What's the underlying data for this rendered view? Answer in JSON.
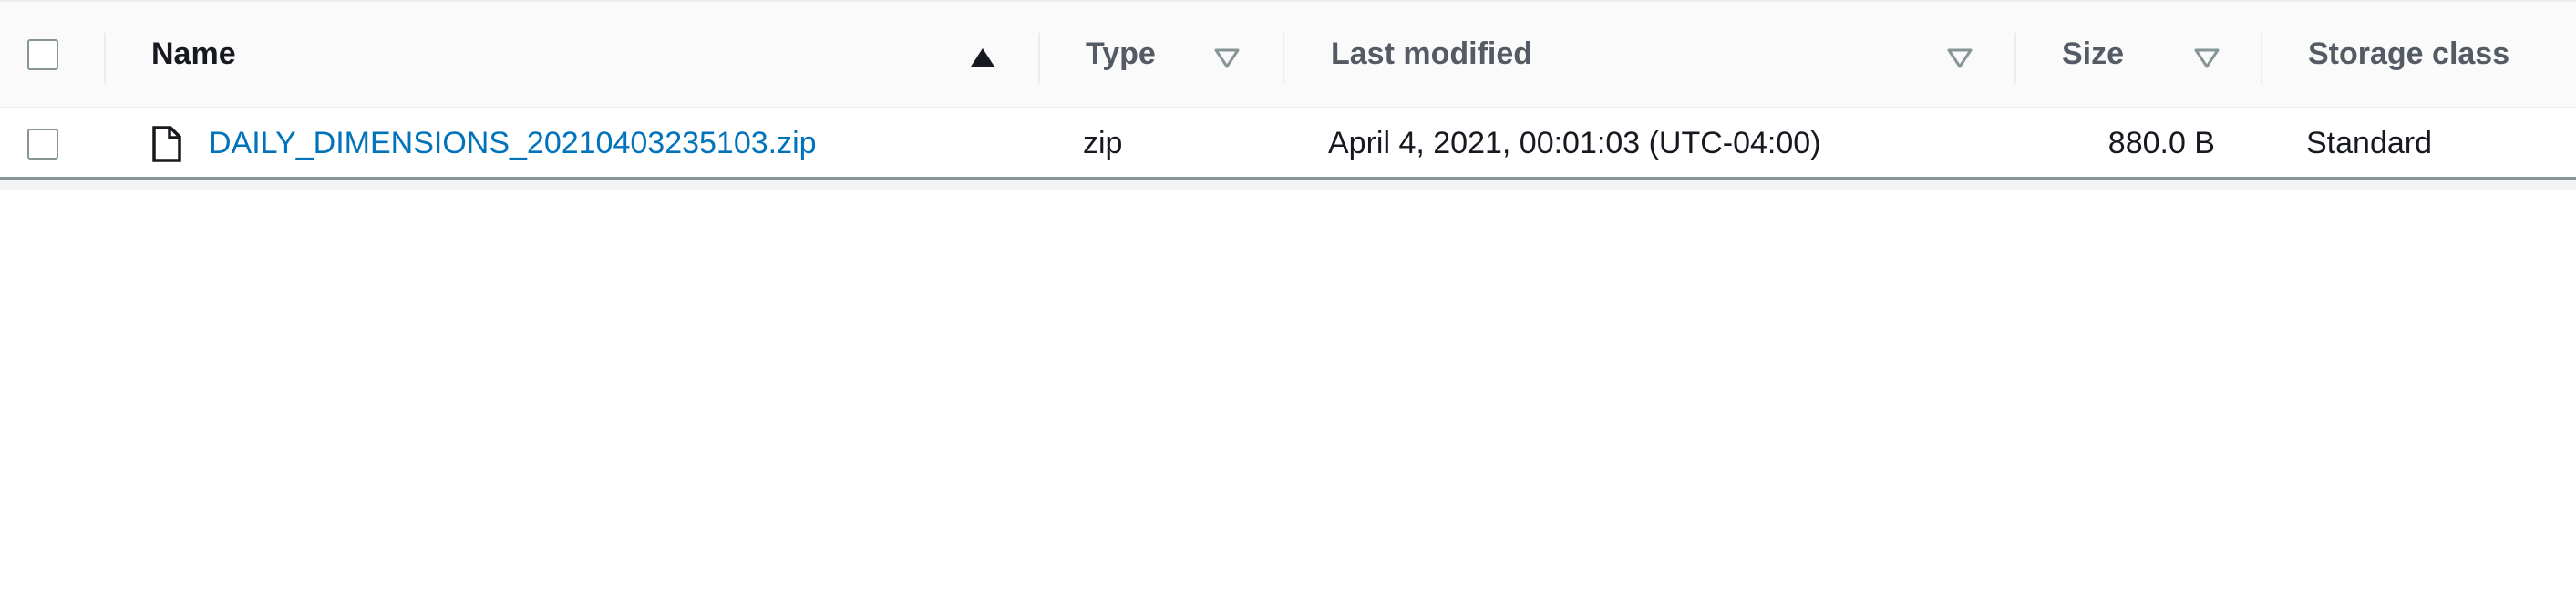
{
  "columns": {
    "name": "Name",
    "type": "Type",
    "last_modified": "Last modified",
    "size": "Size",
    "storage_class": "Storage class"
  },
  "sort": {
    "column": "Name",
    "direction": "ascending",
    "active_icon": "caret-up-filled-icon",
    "inactive_icon": "caret-down-outline-icon"
  },
  "rows": [
    {
      "name": "DAILY_DIMENSIONS_20210403235103.zip",
      "type": "zip",
      "last_modified": "April 4, 2021, 00:01:03 (UTC-04:00)",
      "size": "880.0 B",
      "storage_class": "Standard",
      "icon": "file-icon",
      "selected": false
    }
  ],
  "colors": {
    "link": "#0073bb",
    "header_text": "#545b64",
    "body_text": "#16191f",
    "sort_inactive": "#879596"
  }
}
